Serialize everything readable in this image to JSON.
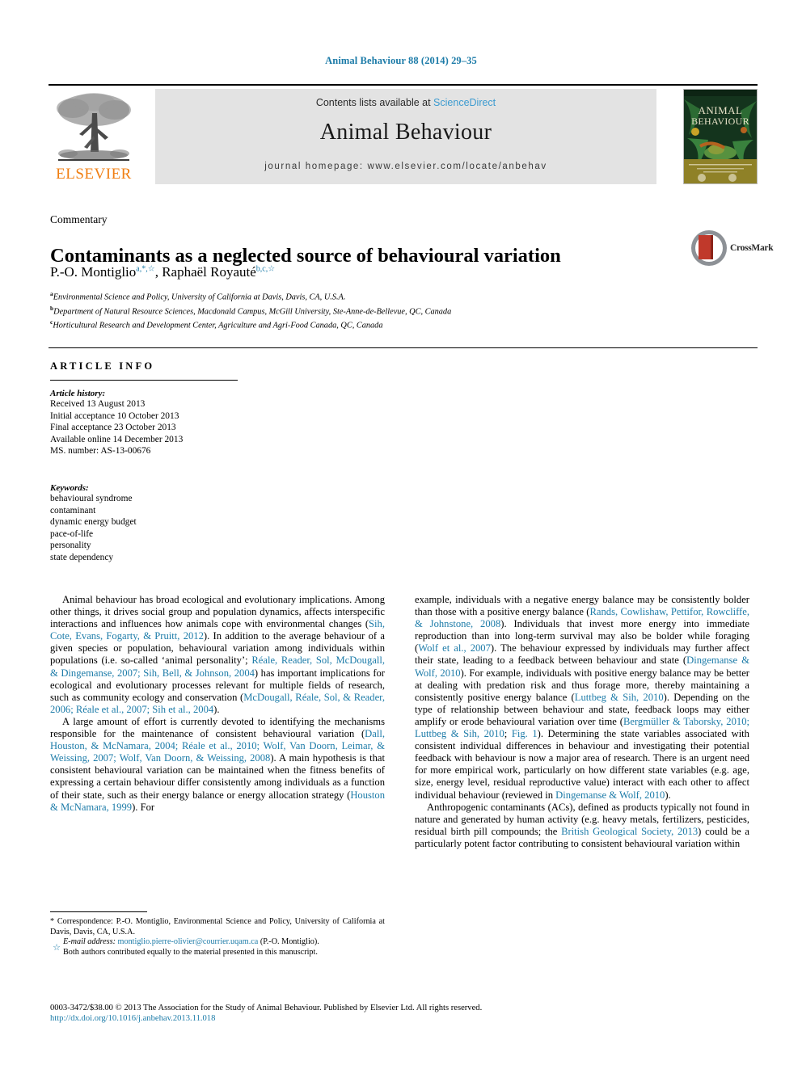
{
  "running_head": "Animal Behaviour 88 (2014) 29–35",
  "masthead": {
    "contents_prefix": "Contents lists available at ",
    "sciencedirect": "ScienceDirect",
    "journal_title": "Animal Behaviour",
    "homepage": "journal homepage: www.elsevier.com/locate/anbehav",
    "publisher_logo_text": "ELSEVIER",
    "cover_title_line1": "ANIMAL",
    "cover_title_line2": "BEHAVIOUR",
    "link_color": "#3c9bd0",
    "band_color": "#e3e3e3"
  },
  "crossmark": {
    "label": "CrossMark"
  },
  "article": {
    "doctype": "Commentary",
    "title": "Contaminants as a neglected source of behavioural variation",
    "author1": "P.-O. Montiglio",
    "author1_marks": "a,*,☆",
    "author2": "Raphaël Royauté",
    "author2_marks": "b,c,☆",
    "affiliations": [
      {
        "mark": "a",
        "text": "Environmental Science and Policy, University of California at Davis, Davis, CA, U.S.A."
      },
      {
        "mark": "b",
        "text": "Department of Natural Resource Sciences, Macdonald Campus, McGill University, Ste-Anne-de-Bellevue, QC, Canada"
      },
      {
        "mark": "c",
        "text": "Horticultural Research and Development Center, Agriculture and Agri-Food Canada, QC, Canada"
      }
    ]
  },
  "article_info": {
    "heading": "ARTICLE INFO",
    "history_label": "Article history:",
    "history": [
      "Received 13 August 2013",
      "Initial acceptance 10 October 2013",
      "Final acceptance 23 October 2013",
      "Available online 14 December 2013",
      "MS. number: AS-13-00676"
    ],
    "keywords_label": "Keywords:",
    "keywords": [
      "behavioural syndrome",
      "contaminant",
      "dynamic energy budget",
      "pace-of-life",
      "personality",
      "state dependency"
    ]
  },
  "body": {
    "left": {
      "p1_a": "Animal behaviour has broad ecological and evolutionary implications. Among other things, it drives social group and population dynamics, affects interspecific interactions and influences how animals cope with environmental changes (",
      "p1_c1": "Sih, Cote, Evans, Fogarty, & Pruitt, 2012",
      "p1_b": "). In addition to the average behaviour of a given species or population, behavioural variation among individuals within populations (i.e. so-called ‘animal personality’; ",
      "p1_c2": "Réale, Reader, Sol, McDougall, & Dingemanse, 2007; Sih, Bell, & Johnson, 2004",
      "p1_d": ") has important implications for ecological and evolutionary processes relevant for multiple fields of research, such as community ecology and conservation (",
      "p1_c3": "McDougall, Réale, Sol, & Reader, 2006; Réale et al., 2007; Sih et al., 2004",
      "p1_e": ").",
      "p2_a": "A large amount of effort is currently devoted to identifying the mechanisms responsible for the maintenance of consistent behavioural variation (",
      "p2_c1": "Dall, Houston, & McNamara, 2004; Réale et al., 2010; Wolf, Van Doorn, Leimar, & Weissing, 2007; Wolf, Van Doorn, & Weissing, 2008",
      "p2_b": "). A main hypothesis is that consistent behavioural variation can be maintained when the fitness benefits of expressing a certain behaviour differ consistently among individuals as a function of their state, such as their energy balance or energy allocation strategy (",
      "p2_c2": "Houston & McNamara, 1999",
      "p2_c": "). For"
    },
    "right": {
      "p1_a": "example, individuals with a negative energy balance may be consistently bolder than those with a positive energy balance (",
      "p1_c1": "Rands, Cowlishaw, Pettifor, Rowcliffe, & Johnstone, 2008",
      "p1_b": "). Individuals that invest more energy into immediate reproduction than into long-term survival may also be bolder while foraging (",
      "p1_c2": "Wolf et al., 2007",
      "p1_c": "). The behaviour expressed by individuals may further affect their state, leading to a feedback between behaviour and state (",
      "p1_c3": "Dingemanse & Wolf, 2010",
      "p1_d": "). For example, individuals with positive energy balance may be better at dealing with predation risk and thus forage more, thereby maintaining a consistently positive energy balance (",
      "p1_c4": "Luttbeg & Sih, 2010",
      "p1_e": "). Depending on the type of relationship between behaviour and state, feedback loops may either amplify or erode behavioural variation over time (",
      "p1_c5": "Bergmüller & Taborsky, 2010; Luttbeg & Sih, 2010",
      "p1_f": "; ",
      "p1_c6": "Fig. 1",
      "p1_g": "). Determining the state variables associated with consistent individual differences in behaviour and investigating their potential feedback with behaviour is now a major area of research. There is an urgent need for more empirical work, particularly on how different state variables (e.g. age, size, energy level, residual reproductive value) interact with each other to affect individual behaviour (reviewed in ",
      "p1_c7": "Dingemanse & Wolf, 2010",
      "p1_h": ").",
      "p2_a": "Anthropogenic contaminants (ACs), defined as products typically not found in nature and generated by human activity (e.g. heavy metals, fertilizers, pesticides, residual birth pill compounds; the ",
      "p2_c1": "British Geological Society, 2013",
      "p2_b": ") could be a particularly potent factor contributing to consistent behavioural variation within"
    }
  },
  "footnotes": {
    "correspondence": "* Correspondence: P.-O. Montiglio, Environmental Science and Policy, University of California at Davis, Davis, CA, U.S.A.",
    "email_label": "E-mail address:",
    "email": "montiglio.pierre-olivier@courrier.uqam.ca",
    "email_suffix": " (P.-O. Montiglio).",
    "equal_mark": "☆",
    "equal_contrib": "Both authors contributed equally to the material presented in this manuscript."
  },
  "page_footer": {
    "copyright": "0003-3472/$38.00 © 2013 The Association for the Study of Animal Behaviour. Published by Elsevier Ltd. All rights reserved.",
    "doi": "http://dx.doi.org/10.1016/j.anbehav.2013.11.018"
  },
  "colors": {
    "link": "#1c7ba8",
    "elsevier_orange": "#f07f13",
    "crossmark_red": "#c0392b"
  }
}
